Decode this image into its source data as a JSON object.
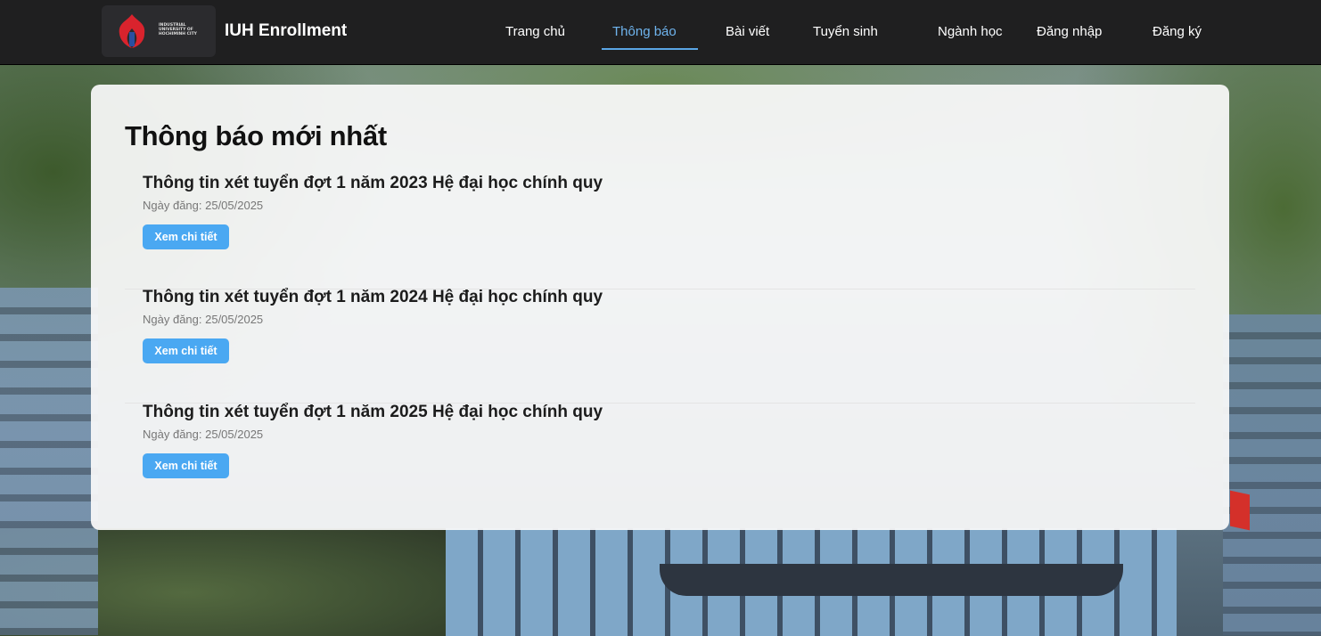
{
  "header": {
    "logo_text": "INDUSTRIAL UNIVERSITY OF HOCHIMINH CITY",
    "brand": "IUH Enrollment",
    "nav": [
      {
        "label": "Trang chủ",
        "active": false
      },
      {
        "label": "Thông báo",
        "active": true
      },
      {
        "label": "Bài viết",
        "active": false
      },
      {
        "label": "Tuyển sinh",
        "active": false
      },
      {
        "label": "Ngành học",
        "active": false
      },
      {
        "label": "Đăng nhập",
        "active": false
      },
      {
        "label": "Đăng ký",
        "active": false
      }
    ],
    "accent_color": "#5aa6e6"
  },
  "main": {
    "title": "Thông báo mới nhất",
    "notices": [
      {
        "title": "Thông tin xét tuyển đợt 1 năm 2023 Hệ đại học chính quy",
        "date": "Ngày đăng: 25/05/2025",
        "button": "Xem chi tiết"
      },
      {
        "title": "Thông tin xét tuyển đợt 1 năm 2024 Hệ đại học chính quy",
        "date": "Ngày đăng: 25/05/2025",
        "button": "Xem chi tiết"
      },
      {
        "title": "Thông tin xét tuyển đợt 1 năm 2025 Hệ đại học chính quy",
        "date": "Ngày đăng: 25/05/2025",
        "button": "Xem chi tiết"
      }
    ],
    "button_color": "#4aa8f2"
  }
}
